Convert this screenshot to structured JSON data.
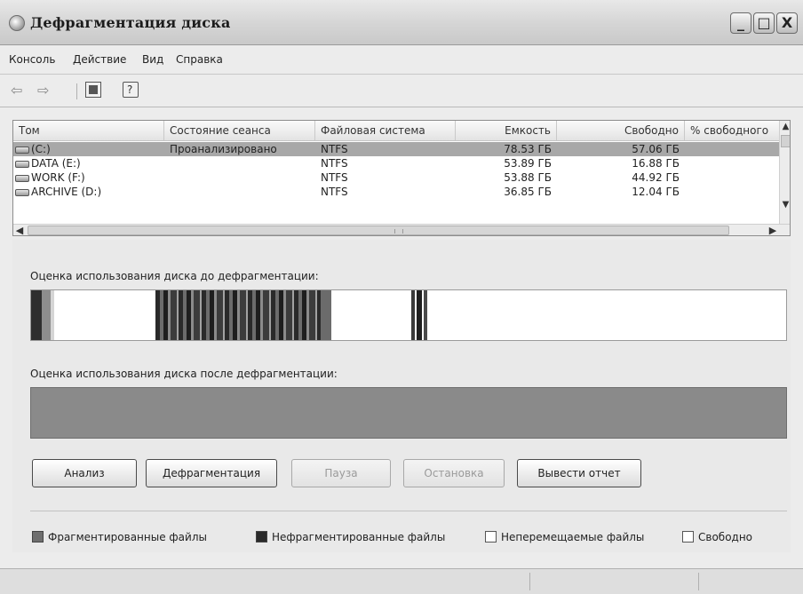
{
  "window": {
    "title": "Дефрагментация диска",
    "minimize": "_",
    "maximize": "□",
    "close": "X"
  },
  "menu": [
    "Консоль",
    "Действие",
    "Вид",
    "Справка"
  ],
  "toolbar": {
    "back": "⇦",
    "forward": "⇨"
  },
  "volumes": {
    "columns": [
      "Том",
      "Состояние сеанса",
      "Файловая система",
      "Емкость",
      "Свободно",
      "% свободного"
    ],
    "rows": [
      {
        "name": "(C:)",
        "status": "Проанализировано",
        "fs": "NTFS",
        "capacity": "78.53 ГБ",
        "free": "57.06 ГБ",
        "pct": "",
        "selected": true
      },
      {
        "name": "DATA (E:)",
        "status": "",
        "fs": "NTFS",
        "capacity": "53.89 ГБ",
        "free": "16.88 ГБ",
        "pct": ""
      },
      {
        "name": "WORK (F:)",
        "status": "",
        "fs": "NTFS",
        "capacity": "53.88 ГБ",
        "free": "44.92 ГБ",
        "pct": ""
      },
      {
        "name": "ARCHIVE (D:)",
        "status": "",
        "fs": "NTFS",
        "capacity": "36.85 ГБ",
        "free": "12.04 ГБ",
        "pct": ""
      }
    ]
  },
  "analysis": {
    "before_label": "Оценка использования диска до дефрагментации:",
    "after_label": "Оценка использования диска после дефрагментации:"
  },
  "buttons": {
    "analyze": "Анализ",
    "defrag": "Дефрагментация",
    "pause": "Пауза",
    "stop": "Остановка",
    "report": "Вывести отчет"
  },
  "legend": {
    "fragmented": "Фрагментированные файлы",
    "contiguous": "Нефрагментированные файлы",
    "unmovable": "Неперемещаемые файлы",
    "free": "Свободно"
  },
  "colors": {
    "fragmented": "#6e6e6e",
    "contiguous": "#2a2a2a",
    "unmovable": "#ffffff",
    "free": "#ffffff",
    "selection": "#a8a8a8"
  }
}
